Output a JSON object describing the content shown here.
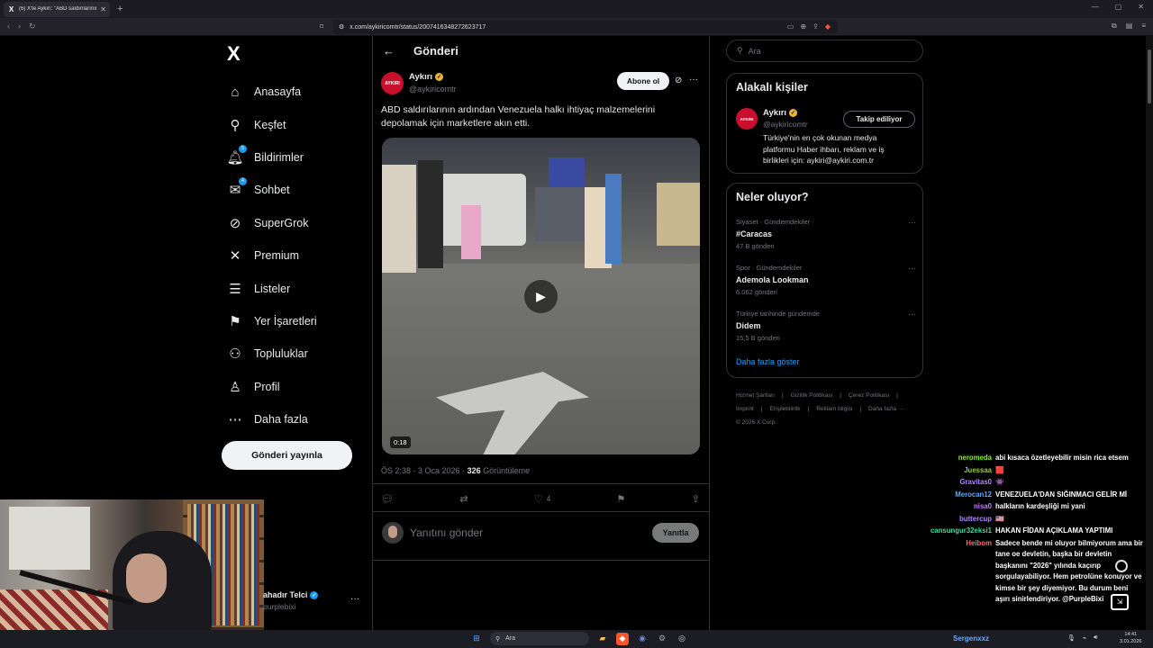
{
  "browser": {
    "tab_title": "(6) X'te Aykırı: \"ABD saldırılarının...",
    "url": "x.com/aykiricomtr/status/2007416348272623717"
  },
  "nav": {
    "logo": "X",
    "items": [
      {
        "label": "Anasayfa",
        "icon": "home-icon"
      },
      {
        "label": "Keşfet",
        "icon": "search-icon"
      },
      {
        "label": "Bildirimler",
        "icon": "bell-icon",
        "badge": "5"
      },
      {
        "label": "Sohbet",
        "icon": "mail-icon",
        "badge": "4"
      },
      {
        "label": "SuperGrok",
        "icon": "grok-icon"
      },
      {
        "label": "Premium",
        "icon": "x-icon"
      },
      {
        "label": "Listeler",
        "icon": "list-icon"
      },
      {
        "label": "Yer İşaretleri",
        "icon": "bookmark-icon"
      },
      {
        "label": "Topluluklar",
        "icon": "people-icon"
      },
      {
        "label": "Profil",
        "icon": "person-icon"
      },
      {
        "label": "Daha fazla",
        "icon": "more-circle-icon"
      }
    ],
    "post_button": "Gönderi yayınla"
  },
  "account": {
    "name": "ahadır Telci",
    "handle": "purplebixi"
  },
  "header": {
    "title": "Gönderi"
  },
  "tweet": {
    "author_name": "Aykırı",
    "author_handle": "@aykiricomtr",
    "avatar_text": "AYKIRI",
    "subscribe_label": "Abone ol",
    "text": "ABD saldırılarının ardından Venezuela halkı ihtiyaç malzemelerini depolamak için marketlere akın etti.",
    "video_duration": "0:18",
    "time": "ÖS 2:38 · 3 Oca 2026 · ",
    "views": "326",
    "views_label": " Görüntüleme",
    "likes": "4",
    "reply_placeholder": "Yanıtını gönder",
    "reply_button": "Yanıtla"
  },
  "search": {
    "placeholder": "Ara"
  },
  "related": {
    "title": "Alakalı kişiler",
    "name": "Aykırı",
    "handle": "@aykiricomtr",
    "avatar_text": "AYKIRI",
    "bio": "Türkiye'nin en çok okunan medya platformu Haber ihbarı, reklam ve iş birlikleri için: aykiri@aykiri.com.tr",
    "follow_label": "Takip ediliyor"
  },
  "trends": {
    "title": "Neler oluyor?",
    "items": [
      {
        "category": "Siyaset · Gündemdekiler",
        "name": "#Caracas",
        "count": "47 B gönderi"
      },
      {
        "category": "Spor · Gündemdekiler",
        "name": "Ademola Lookman",
        "count": "6.062 gönderi"
      },
      {
        "category": "Türkiye tarihinde gündemde",
        "name": "Didem",
        "count": "15,5 B gönderi"
      }
    ],
    "show_more": "Daha fazla göster"
  },
  "footer": {
    "links": [
      "Hizmet Şartları",
      "|",
      "Gizlilik Politikası",
      "|",
      "Çerez Politikası",
      "|",
      "Imprint",
      "|",
      "Erişilebilirlik",
      "|",
      "Reklam bilgisi",
      "|",
      "Daha fazla ···"
    ],
    "copyright": "© 2026 X Corp."
  },
  "chat": [
    {
      "user": "neromeda",
      "color": "#7cfc00",
      "text": "abi kısaca özetleyebilir misin rica etsem"
    },
    {
      "user": "Juessaa",
      "color": "#9acd32",
      "text": "🟥"
    },
    {
      "user": "Gravitas0",
      "color": "#b388ff",
      "text": "👾"
    },
    {
      "user": "Merocan12",
      "color": "#5fa8ff",
      "text": "VENEZUELA'DAN SIĞINMACI GELİR Mİ"
    },
    {
      "user": "nisa0",
      "color": "#c77dff",
      "text": "halkların kardeşliği mi yani"
    },
    {
      "user": "buttercup",
      "color": "#b388ff",
      "text": "🇺🇸"
    },
    {
      "user": "cansungur32eksi1",
      "color": "#3cdc9c",
      "text": "HAKAN FİDAN AÇIKLAMA YAPTIMI"
    },
    {
      "user": "Heibom",
      "color": "#ff6a6a",
      "text": "Sadece bende mi oluyor bilmiyorum ama bir tane oe devletin, başka bir devletin başkanını \"2026\" yılında kaçırıp sorgulayabiliyor. Hem petrolüne konuyor ve kimse bir şey diyemiyor. Bu durum beni aşırı sinirlendiriyor. @PurpleBixi"
    }
  ],
  "taskbar": {
    "search": "Ara",
    "user": "Sergenxxz",
    "time": "14:41",
    "date": "3.01.2026"
  }
}
